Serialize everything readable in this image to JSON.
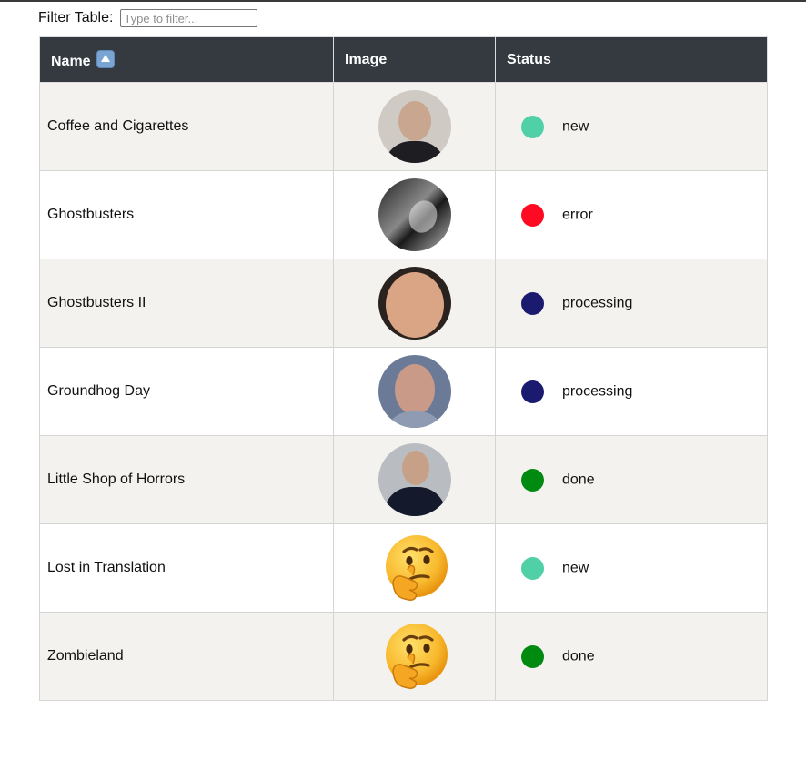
{
  "filter": {
    "label": "Filter Table:",
    "placeholder": "Type to filter...",
    "value": ""
  },
  "table": {
    "headers": {
      "name": "Name",
      "image": "Image",
      "status": "Status"
    },
    "sort": {
      "column": "name",
      "direction": "ascending",
      "icon": "up-arrow-button-icon"
    },
    "status_colors": {
      "new": "#50d0a6",
      "error": "#ff0a23",
      "processing": "#1a1a6e",
      "done": "#008a10"
    },
    "rows": [
      {
        "name": "Coffee and Cigarettes",
        "image": "avatar-photo",
        "status": "new"
      },
      {
        "name": "Ghostbusters",
        "image": "avatar-photo",
        "status": "error"
      },
      {
        "name": "Ghostbusters II",
        "image": "avatar-photo",
        "status": "processing"
      },
      {
        "name": "Groundhog Day",
        "image": "avatar-photo",
        "status": "processing"
      },
      {
        "name": "Little Shop of Horrors",
        "image": "avatar-photo",
        "status": "done"
      },
      {
        "name": "Lost in Translation",
        "image": "thinking-face-emoji-icon",
        "status": "new"
      },
      {
        "name": "Zombieland",
        "image": "thinking-face-emoji-icon",
        "status": "done"
      }
    ]
  }
}
